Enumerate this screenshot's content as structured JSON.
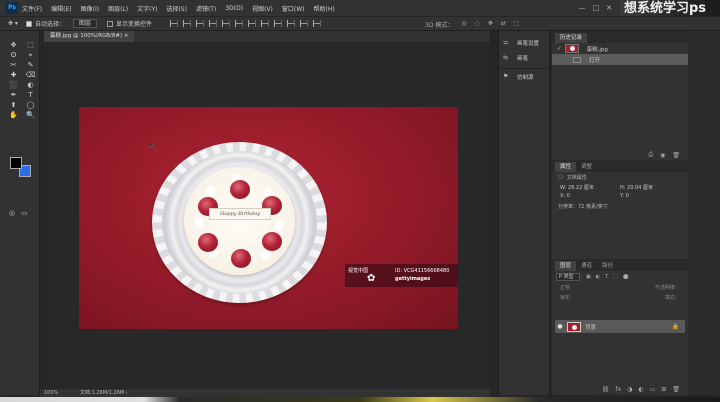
{
  "menubar": {
    "logo": "Ps",
    "items": [
      "文件(F)",
      "编辑(E)",
      "图像(I)",
      "图层(L)",
      "文字(Y)",
      "选择(S)",
      "滤镜(T)",
      "3D(D)",
      "视图(V)",
      "窗口(W)",
      "帮助(H)"
    ],
    "window_controls": [
      "—",
      "□",
      "✕"
    ]
  },
  "banner": {
    "text": "想系统学习ps"
  },
  "options": {
    "auto_select_label": "自动选择：",
    "auto_select_value": "图层",
    "transform_label": "显示变换控件",
    "mode_3d_label": "3D 模式："
  },
  "tools": [
    "✥",
    "⬚",
    "ʘ",
    "⌖",
    "✂",
    "✎",
    "✚",
    "⌫",
    "⬛",
    "◐",
    "✒",
    "T",
    "⬆",
    "◯",
    "✋",
    "🔍"
  ],
  "document_tab": {
    "label": "蛋糕.jpg @ 100%(RGB/8#)",
    "close": "×"
  },
  "canvas": {
    "card_text": "Happy Birthday",
    "watermark": {
      "logo": "视觉中国",
      "id": "ID: VCG41156668480",
      "brand": "gettyimages"
    },
    "cursor": "↖"
  },
  "statusbar": {
    "zoom": "100%",
    "doc": "文档:1.26M/1.26M",
    "arrow": "›"
  },
  "mid_panel": {
    "items": [
      {
        "icon": "⚌",
        "label": "画笔设置"
      },
      {
        "icon": "⇆",
        "label": "画笔"
      },
      {
        "icon": "⚑",
        "label": "仿制源"
      }
    ]
  },
  "history": {
    "tab": "历史记录",
    "snapshot": "蛋糕.jpg",
    "steps": [
      "打开"
    ],
    "footer_icons": [
      "⎙",
      "◉",
      "🗑"
    ]
  },
  "properties": {
    "tabs": [
      "属性",
      "调整"
    ],
    "title": "文档属性",
    "w_label": "W:",
    "w_value": "28.22 厘米",
    "h_label": "H:",
    "h_value": "20.04 厘米",
    "x_label": "X:",
    "x_value": "0",
    "y_label": "Y:",
    "y_value": "0",
    "resolution": "分辨率：72 像素/英寸"
  },
  "layers": {
    "tabs": [
      "图层",
      "通道",
      "路径"
    ],
    "search_placeholder": "P 类型",
    "filter_icons": [
      "▣",
      "◐",
      "T",
      "⬚",
      "⬤"
    ],
    "blend_mode": "正常",
    "opacity_label": "不透明度：",
    "lock_label": "锁定：",
    "fill_label": "填充：",
    "layer_name": "背景",
    "eye": "●",
    "lock_icon": "🔒",
    "footer_icons": [
      "⛓",
      "fx",
      "◑",
      "◐",
      "▭",
      "⊞",
      "🗑"
    ]
  },
  "colors": {
    "foreground": "#000000",
    "background": "#2a6fe8",
    "photo": "#9b1c2c"
  }
}
